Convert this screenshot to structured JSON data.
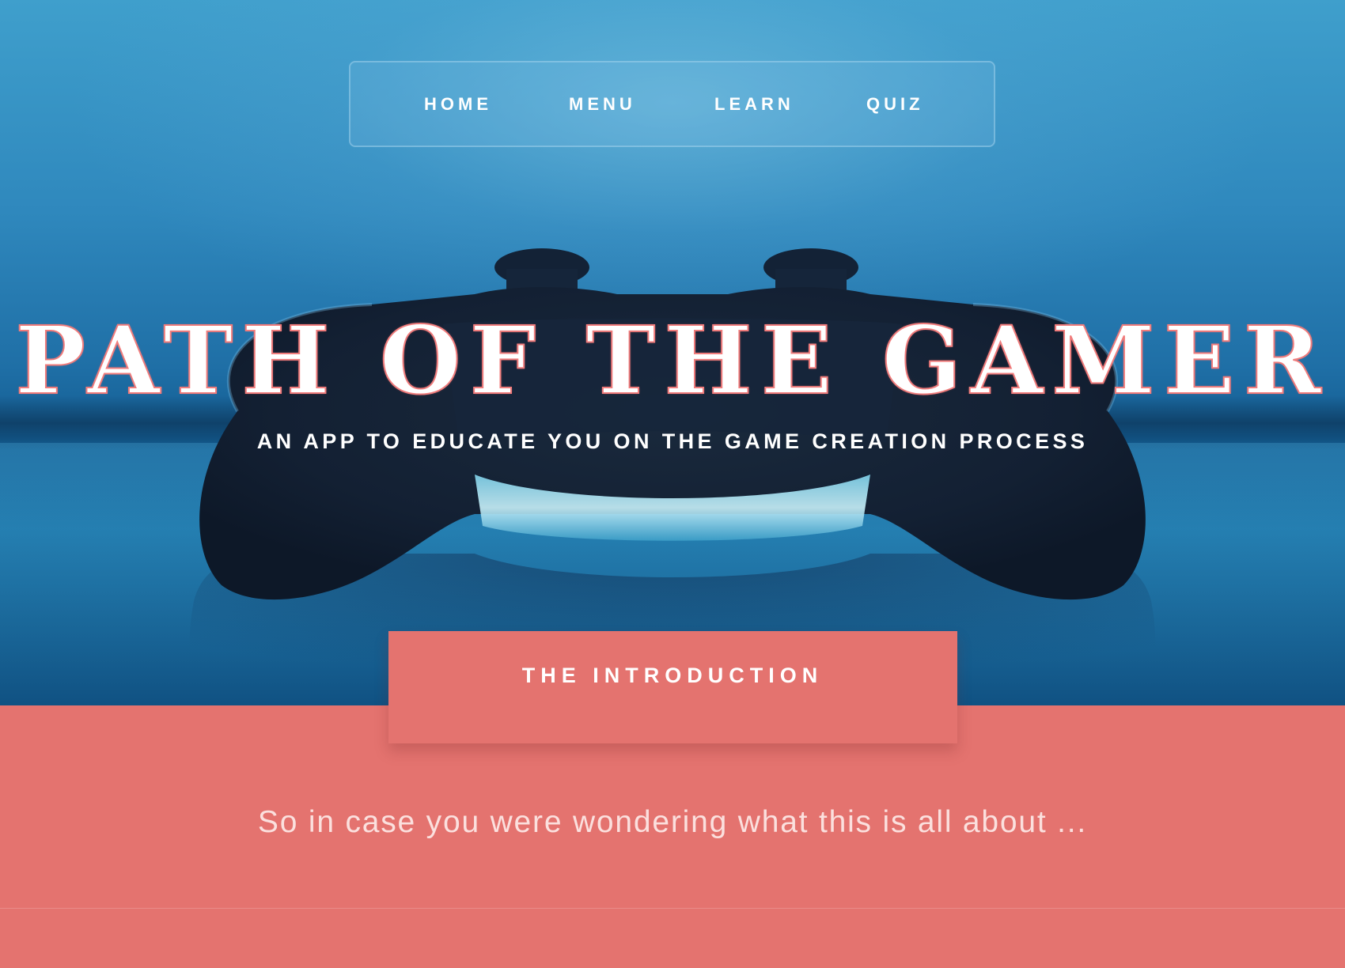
{
  "nav": {
    "items": [
      {
        "label": "HOME"
      },
      {
        "label": "MENU"
      },
      {
        "label": "LEARN"
      },
      {
        "label": "QUIZ"
      }
    ]
  },
  "hero": {
    "title": "PATH OF THE GAMER",
    "subtitle": "AN APP TO EDUCATE YOU ON THE GAME CREATION PROCESS",
    "image": "game-controller-image"
  },
  "intro": {
    "tab_label": "THE INTRODUCTION",
    "text": "So in case you were wondering what this is all about ..."
  },
  "colors": {
    "accent": "#e4736f",
    "hero_blue": "#2f88bd",
    "title_outline": "#f07c7c",
    "text_light": "#ffffff"
  }
}
